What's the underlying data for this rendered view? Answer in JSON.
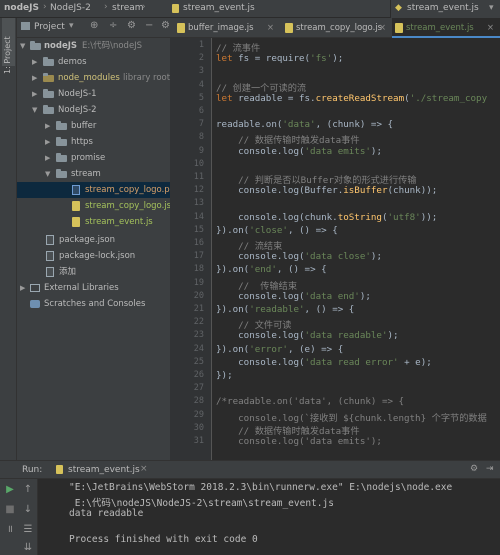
{
  "breadcrumbs": [
    "nodeJS",
    "NodeJS-2",
    "stream",
    "stream_event.js"
  ],
  "run_config": "stream_event.js",
  "left_tool_tab": "1: Project",
  "project_panel": {
    "title": "Project"
  },
  "tree": [
    {
      "label": "nodeJS",
      "suffix": "E:\\代码\\nodeJS",
      "type": "folder",
      "expanded": true
    },
    {
      "label": "demos",
      "type": "folder"
    },
    {
      "label": "node_modules",
      "suffix": "library root",
      "type": "folder"
    },
    {
      "label": "NodeJS-1",
      "type": "folder"
    },
    {
      "label": "NodeJS-2",
      "type": "folder",
      "expanded": true
    },
    {
      "label": "buffer",
      "type": "folder"
    },
    {
      "label": "https",
      "type": "folder"
    },
    {
      "label": "promise",
      "type": "folder"
    },
    {
      "label": "stream",
      "type": "folder",
      "expanded": true
    },
    {
      "label": "stream_copy_logo.png",
      "type": "image"
    },
    {
      "label": "stream_copy_logo.js",
      "type": "js"
    },
    {
      "label": "stream_event.js",
      "type": "js"
    },
    {
      "label": "package.json",
      "type": "file"
    },
    {
      "label": "package-lock.json",
      "type": "file"
    },
    {
      "label": "添加",
      "type": "file"
    },
    {
      "label": "External Libraries",
      "type": "lib"
    },
    {
      "label": "Scratches and Consoles",
      "type": "lib"
    }
  ],
  "tabs": [
    {
      "label": "buffer_image.js"
    },
    {
      "label": "stream_copy_logo.js"
    },
    {
      "label": "stream_event.js",
      "active": true
    }
  ],
  "line_numbers": [
    "1",
    "2",
    "3",
    "4",
    "5",
    "6",
    "7",
    "8",
    "9",
    "10",
    "11",
    "12",
    "13",
    "14",
    "15",
    "16",
    "17",
    "18",
    "19",
    "20",
    "21",
    "22",
    "23",
    "24",
    "25",
    "26",
    "27",
    "28",
    "29",
    "30",
    "31"
  ],
  "code_lines": [
    "// 流事件",
    "let fs = require('fs');",
    "",
    "// 创建一个可读的流",
    "let readable = fs.createReadStream('./stream_copy",
    "",
    "readable.on('data', (chunk) => {",
    "    // 数据传输时触发data事件",
    "    console.log('data emits');",
    "",
    "    // 判断是否以Buffer对象的形式进行传输",
    "    console.log(Buffer.isBuffer(chunk));",
    "",
    "    console.log(chunk.toString('utf8'));",
    "}).on('close', () => {",
    "    // 流结束",
    "    console.log('data close');",
    "}).on('end', () => {",
    "    //  传输结束",
    "    console.log('data end');",
    "}).on('readable', () => {",
    "    // 文件可读",
    "    console.log('data readable');",
    "}).on('error', (e) => {",
    "    console.log('data read error' + e);",
    "});",
    "",
    "/*readable.on('data', (chunk) => {",
    "    console.log(`接收到 ${chunk.length} 个字节的数据",
    "    // 数据传输时触发data事件",
    "    console.log('data emits');"
  ],
  "run_panel": {
    "label": "Run:",
    "tab": "stream_event.js"
  },
  "console_lines": [
    "\"E:\\JetBrains\\WebStorm 2018.2.3\\bin\\runnerw.exe\" E:\\nodejs\\node.exe",
    " E:\\代码\\nodeJS\\NodeJS-2\\stream\\stream_event.js",
    "data readable",
    "",
    "Process finished with exit code 0"
  ]
}
